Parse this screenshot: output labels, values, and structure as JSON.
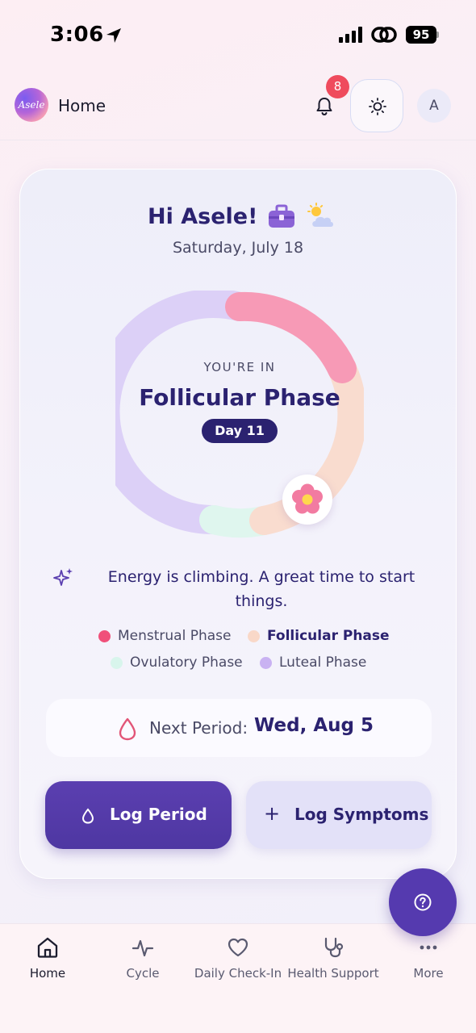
{
  "status_bar": {
    "time": "3:06",
    "battery": "95"
  },
  "header": {
    "logo_text": "Asele",
    "title": "Home",
    "notification_count": "8",
    "avatar_initial": "A"
  },
  "card": {
    "greeting": "Hi Asele!",
    "date": "Saturday, July 18",
    "ring": {
      "label": "YOU'RE IN",
      "phase": "Follicular Phase",
      "day": "Day 11"
    },
    "tip": "Energy is climbing. A great time to start things.",
    "legend": [
      {
        "label": "Menstrual Phase",
        "color": "#f0507a",
        "active": false
      },
      {
        "label": "Follicular Phase",
        "color": "#f9d8c8",
        "active": true
      },
      {
        "label": "Ovulatory Phase",
        "color": "#d8f5ec",
        "active": false
      },
      {
        "label": "Luteal Phase",
        "color": "#c9b2f2",
        "active": false
      }
    ],
    "next_period": {
      "label": "Next Period:",
      "value": "Wed, Aug 5"
    },
    "buttons": {
      "log_period": "Log Period",
      "log_symptoms": "Log Symptoms"
    }
  },
  "bottom_nav": [
    {
      "label": "Home",
      "icon": "home-icon",
      "active": true
    },
    {
      "label": "Cycle",
      "icon": "pulse-icon",
      "active": false
    },
    {
      "label": "Daily Check-In",
      "icon": "heart-icon",
      "active": false
    },
    {
      "label": "Health Support",
      "icon": "stethoscope-icon",
      "active": false
    },
    {
      "label": "More",
      "icon": "more-icon",
      "active": false
    }
  ],
  "colors": {
    "primary": "#553aaf",
    "heading": "#2b2270",
    "badge": "#ef4b5d",
    "menstrual": "#f79ab6",
    "follicular": "#f9d8c8",
    "ovulatory": "#d8f5ec",
    "luteal": "#dcd0f7"
  }
}
